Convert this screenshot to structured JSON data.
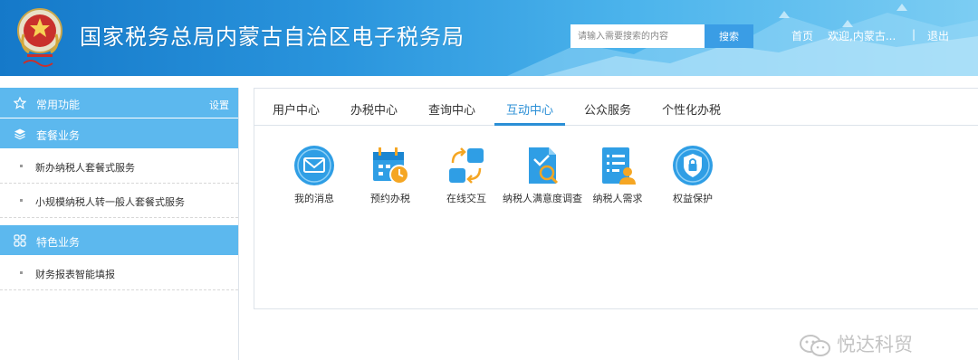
{
  "header": {
    "title": "国家税务总局内蒙古自治区电子税务局",
    "emblem_text": "",
    "search": {
      "placeholder": "请输入需要搜索的内容",
      "button_label": "搜索"
    },
    "nav": {
      "home": "首页",
      "welcome": "欢迎,内蒙古...",
      "separator": "|",
      "logout": "退出"
    }
  },
  "sidebar": {
    "sections": [
      {
        "icon": "star-icon",
        "label": "常用功能",
        "action": "设置",
        "items": []
      },
      {
        "icon": "layers-icon",
        "label": "套餐业务",
        "items": [
          "新办纳税人套餐式服务",
          "小规模纳税人转一般人套餐式服务"
        ]
      },
      {
        "icon": "grid-icon",
        "label": "特色业务",
        "items": [
          "财务报表智能填报"
        ]
      }
    ]
  },
  "main": {
    "tabs": [
      "用户中心",
      "办税中心",
      "查询中心",
      "互动中心",
      "公众服务",
      "个性化办税"
    ],
    "active_tab": "互动中心",
    "functions": [
      {
        "icon": "mail-icon",
        "label": "我的消息"
      },
      {
        "icon": "calendar-clock-icon",
        "label": "预约办税"
      },
      {
        "icon": "exchange-icon",
        "label": "在线交互"
      },
      {
        "icon": "survey-search-icon",
        "label": "纳税人满意度调查"
      },
      {
        "icon": "user-list-icon",
        "label": "纳税人需求"
      },
      {
        "icon": "shield-lock-icon",
        "label": "权益保护"
      }
    ]
  },
  "watermark": {
    "text": "悦达科贸"
  },
  "colors": {
    "accent": "#2b8fd6",
    "sidebar_head": "#5cb8ee",
    "icon_blue": "#2f9ee5",
    "icon_orange": "#f5a623"
  }
}
